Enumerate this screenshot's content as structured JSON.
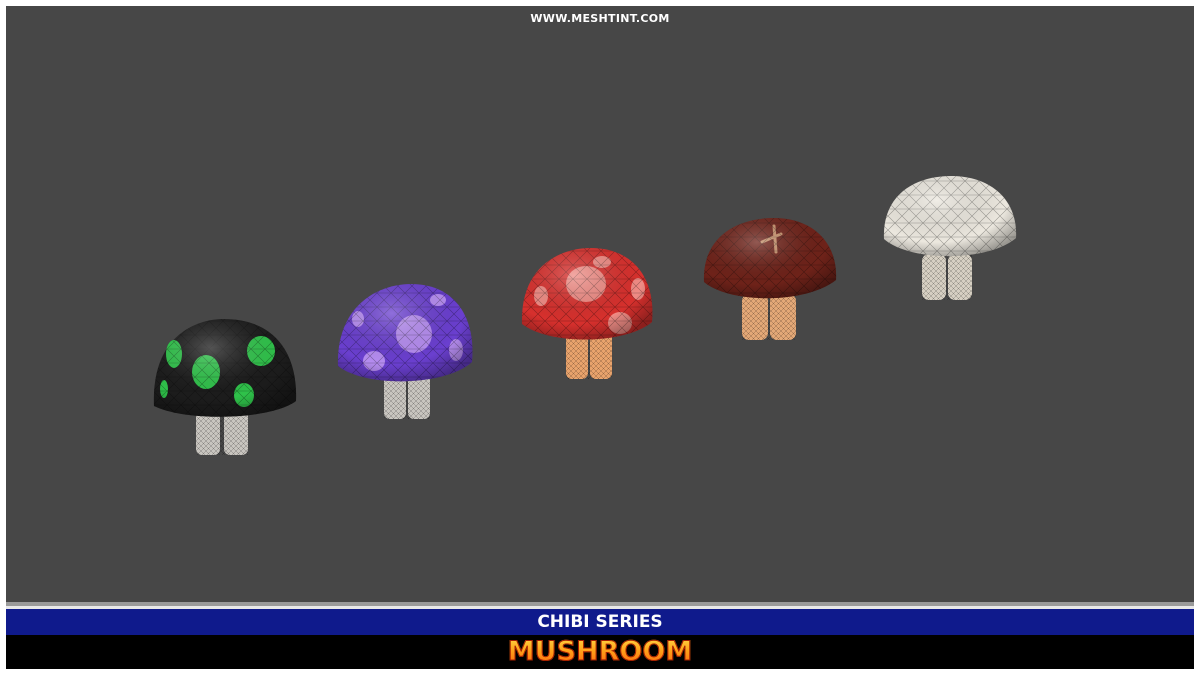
{
  "header": {
    "site_url": "WWW.MESHTINT.COM"
  },
  "footer": {
    "series_label": "CHIBI SERIES",
    "product_title": "MUSHROOM"
  },
  "colors": {
    "background": "#474747",
    "series_bar": "#0f1a8c",
    "title_bar": "#000000",
    "title_gradient_top": "#ffe24a",
    "title_gradient_bottom": "#ff5a0a"
  },
  "mushrooms": [
    {
      "name": "black-green-spotted",
      "cap_color": "#1c1c1c",
      "spot_color": "#2fc24a",
      "leg_color": "#c8c5bf"
    },
    {
      "name": "purple-spotted",
      "cap_color": "#6a3fcf",
      "spot_color": "#b58cf0",
      "leg_color": "#c8c5bf"
    },
    {
      "name": "red-spotted",
      "cap_color": "#d7302d",
      "spot_color": "#ef8b84",
      "leg_color": "#e8a36c"
    },
    {
      "name": "brown-shiitake",
      "cap_color": "#6e2219",
      "spot_color": "#c7906a",
      "leg_color": "#e3a877"
    },
    {
      "name": "white",
      "cap_color": "#ece8df",
      "spot_color": "#ffffff",
      "leg_color": "#d6cfc2"
    }
  ]
}
